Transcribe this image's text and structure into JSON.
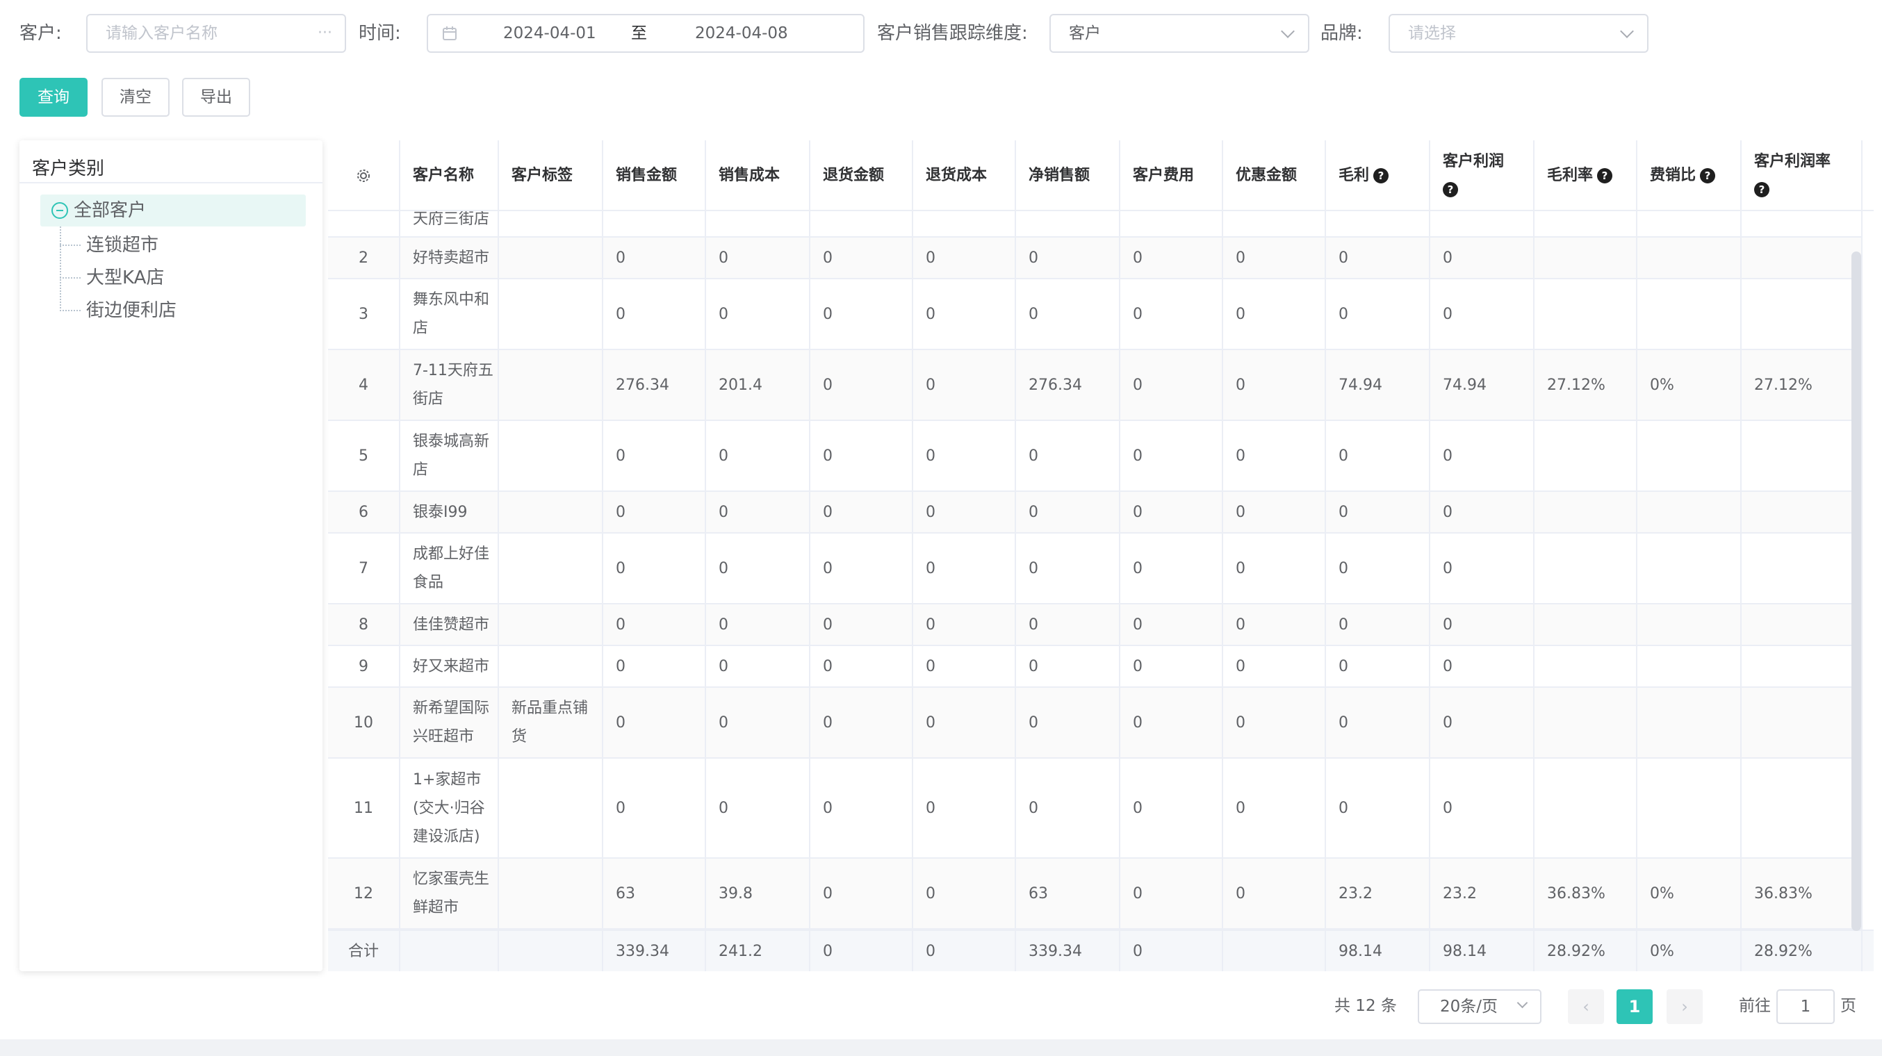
{
  "filters": {
    "customer_label": "客户:",
    "customer_placeholder": "请输入客户名称",
    "time_label": "时间:",
    "date_start": "2024-04-01",
    "date_sep": "至",
    "date_end": "2024-04-08",
    "dimension_label": "客户销售跟踪维度:",
    "dimension_value": "客户",
    "brand_label": "品牌:",
    "brand_placeholder": "请选择"
  },
  "buttons": {
    "query": "查询",
    "clear": "清空",
    "export": "导出"
  },
  "tree": {
    "title": "客户类别",
    "root": "全部客户",
    "children": [
      "连锁超市",
      "大型KA店",
      "街边便利店"
    ]
  },
  "table": {
    "headers": [
      "客户名称",
      "客户标签",
      "销售金额",
      "销售成本",
      "退货金额",
      "退货成本",
      "净销售额",
      "客户费用",
      "优惠金额",
      "毛利",
      "客户利润",
      "毛利率",
      "费销比",
      "客户利润率"
    ],
    "partial_row_name": "天府三街店",
    "rows": [
      {
        "idx": "2",
        "name": "好特卖超市",
        "tag": "",
        "vals": [
          "0",
          "0",
          "0",
          "0",
          "0",
          "0",
          "0",
          "0",
          "0",
          "",
          "",
          ""
        ]
      },
      {
        "idx": "3",
        "name": "舞东风中和店",
        "tag": "",
        "vals": [
          "0",
          "0",
          "0",
          "0",
          "0",
          "0",
          "0",
          "0",
          "0",
          "",
          "",
          ""
        ]
      },
      {
        "idx": "4",
        "name": "7-11天府五街店",
        "tag": "",
        "vals": [
          "276.34",
          "201.4",
          "0",
          "0",
          "276.34",
          "0",
          "0",
          "74.94",
          "74.94",
          "27.12%",
          "0%",
          "27.12%"
        ]
      },
      {
        "idx": "5",
        "name": "银泰城高新店",
        "tag": "",
        "vals": [
          "0",
          "0",
          "0",
          "0",
          "0",
          "0",
          "0",
          "0",
          "0",
          "",
          "",
          ""
        ]
      },
      {
        "idx": "6",
        "name": "银泰I99",
        "tag": "",
        "vals": [
          "0",
          "0",
          "0",
          "0",
          "0",
          "0",
          "0",
          "0",
          "0",
          "",
          "",
          ""
        ]
      },
      {
        "idx": "7",
        "name": "成都上好佳食品",
        "tag": "",
        "vals": [
          "0",
          "0",
          "0",
          "0",
          "0",
          "0",
          "0",
          "0",
          "0",
          "",
          "",
          ""
        ]
      },
      {
        "idx": "8",
        "name": "佳佳赞超市",
        "tag": "",
        "vals": [
          "0",
          "0",
          "0",
          "0",
          "0",
          "0",
          "0",
          "0",
          "0",
          "",
          "",
          ""
        ]
      },
      {
        "idx": "9",
        "name": "好又来超市",
        "tag": "",
        "vals": [
          "0",
          "0",
          "0",
          "0",
          "0",
          "0",
          "0",
          "0",
          "0",
          "",
          "",
          ""
        ]
      },
      {
        "idx": "10",
        "name": "新希望国际兴旺超市",
        "tag": "新品重点铺货",
        "vals": [
          "0",
          "0",
          "0",
          "0",
          "0",
          "0",
          "0",
          "0",
          "0",
          "",
          "",
          ""
        ]
      },
      {
        "idx": "11",
        "name": "1+家超市(交大·归谷建设派店)",
        "tag": "",
        "vals": [
          "0",
          "0",
          "0",
          "0",
          "0",
          "0",
          "0",
          "0",
          "0",
          "",
          "",
          ""
        ]
      },
      {
        "idx": "12",
        "name": "忆家蛋壳生鲜超市",
        "tag": "",
        "vals": [
          "63",
          "39.8",
          "0",
          "0",
          "63",
          "0",
          "0",
          "23.2",
          "23.2",
          "36.83%",
          "0%",
          "36.83%"
        ]
      }
    ],
    "footer": {
      "label": "合计",
      "vals": [
        "339.34",
        "241.2",
        "0",
        "0",
        "339.34",
        "0",
        "",
        "98.14",
        "98.14",
        "28.92%",
        "0%",
        "28.92%"
      ]
    }
  },
  "pagination": {
    "total": "共 12 条",
    "page_size": "20条/页",
    "current_page": "1",
    "goto_prefix": "前往",
    "goto_value": "1",
    "goto_suffix": "页"
  }
}
